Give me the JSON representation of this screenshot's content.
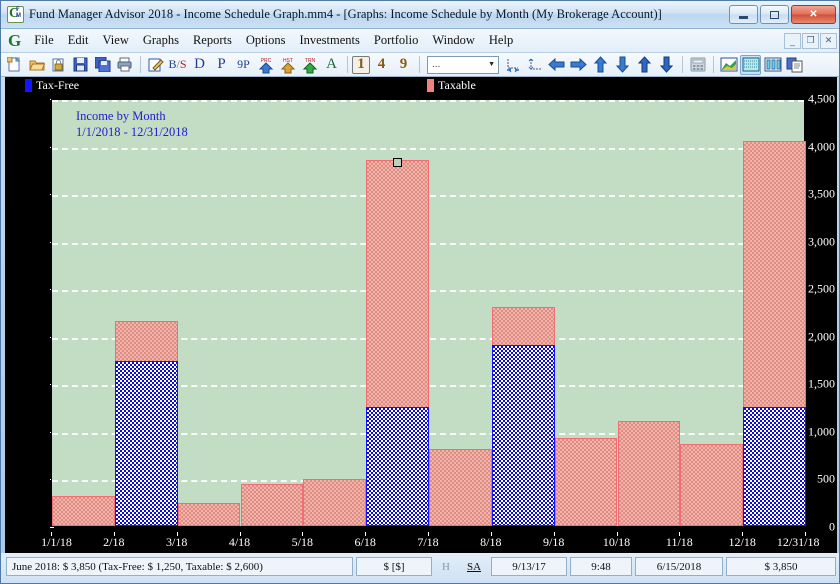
{
  "window": {
    "title": "Fund Manager Advisor 2018 - Income Schedule Graph.mm4 - [Graphs: Income Schedule by Month (My Brokerage Account)]",
    "app_icon": "fund-manager-icon",
    "controls": {
      "minimize": "–",
      "maximize": "□",
      "close": "✕"
    },
    "mdi_controls": {
      "minimize": "_",
      "restore": "❐",
      "close": "✕"
    }
  },
  "menu": {
    "logo": "G",
    "items": [
      "File",
      "Edit",
      "View",
      "Graphs",
      "Reports",
      "Options",
      "Investments",
      "Portfolio",
      "Window",
      "Help"
    ]
  },
  "toolbar": {
    "groups": [
      [
        {
          "name": "new-file-icon",
          "glyph": "❐"
        },
        {
          "name": "open-folder-icon",
          "glyph": "Ὄ2"
        },
        {
          "name": "lock-file-icon",
          "glyph": "❑"
        },
        {
          "name": "save-icon",
          "glyph": "Ὃe"
        },
        {
          "name": "save-all-icon",
          "glyph": "⧉"
        },
        {
          "name": "print-icon",
          "glyph": "⎙"
        }
      ],
      [
        {
          "name": "edit-note-icon",
          "glyph": "✎"
        },
        {
          "name": "bs-ratio-icon",
          "glyph": "B/S"
        },
        {
          "name": "dividend-icon",
          "glyph": "D"
        },
        {
          "name": "price-icon",
          "glyph": "P"
        },
        {
          "name": "nine-price-icon",
          "glyph": "9P"
        },
        {
          "name": "price-update-icon",
          "glyph": "PRC"
        },
        {
          "name": "history-update-icon",
          "glyph": "HST"
        },
        {
          "name": "transaction-update-icon",
          "glyph": "TRN"
        },
        {
          "name": "font-icon",
          "glyph": "A"
        }
      ],
      [
        {
          "name": "view-one-icon",
          "glyph": "1"
        },
        {
          "name": "view-four-icon",
          "glyph": "4"
        },
        {
          "name": "view-nine-icon",
          "glyph": "9"
        }
      ]
    ],
    "combo_value": "...",
    "combo_arrow": "▼",
    "zoom_icons": [
      {
        "name": "fit-horizontal-icon",
        "glyph": "↧"
      },
      {
        "name": "fit-vertical-icon",
        "glyph": "↥"
      }
    ],
    "nav_icons": [
      {
        "name": "arrow-left-icon",
        "glyph": "⬅"
      },
      {
        "name": "arrow-right-icon",
        "glyph": "➡"
      },
      {
        "name": "arrow-up-icon",
        "glyph": "⬆"
      },
      {
        "name": "arrow-down-icon",
        "glyph": "⬇"
      },
      {
        "name": "arrow-up-alt-icon",
        "glyph": "⬆"
      },
      {
        "name": "arrow-down-alt-icon",
        "glyph": "⬇"
      }
    ],
    "right_icons": [
      {
        "name": "calculator-icon",
        "glyph": "⌸"
      },
      {
        "name": "area-chart-icon",
        "glyph": "◢"
      },
      {
        "name": "bar-chart-icon",
        "glyph": "▒"
      },
      {
        "name": "column-chart-icon",
        "glyph": "‖"
      },
      {
        "name": "copy-report-icon",
        "glyph": "⧉"
      }
    ]
  },
  "statusbar": {
    "message": "June 2018: $ 3,850 (Tax-Free: $ 1,250, Taxable: $ 2,600)",
    "currency": "$ [$]",
    "h_flag": "H",
    "sa_flag": "SA",
    "date_short": "9/13/17",
    "time": "9:48",
    "date_long": "6/15/2018",
    "total": "$ 3,850"
  },
  "chart_data": {
    "type": "bar",
    "stacked": true,
    "title": "Income by Month",
    "subtitle": "1/1/2018 - 12/31/2018",
    "xlabel": "",
    "ylabel": "",
    "ylim": [
      0,
      4500
    ],
    "yticks": [
      0,
      500,
      1000,
      1500,
      2000,
      2500,
      3000,
      3500,
      4000,
      4500
    ],
    "ytick_labels": [
      "0",
      "500",
      "1,000",
      "1,500",
      "2,000",
      "2,500",
      "3,000",
      "3,500",
      "4,000",
      "4,500"
    ],
    "grid": true,
    "legend_position": "top",
    "plot_bg": "#c3dcc4",
    "categories": [
      "1/18",
      "2/18",
      "3/18",
      "4/18",
      "5/18",
      "6/18",
      "7/18",
      "8/18",
      "9/18",
      "10/18",
      "11/18",
      "12/18"
    ],
    "xtick_labels": [
      "1/1/18",
      "2/18",
      "3/18",
      "4/18",
      "5/18",
      "6/18",
      "7/18",
      "8/18",
      "9/18",
      "10/18",
      "11/18",
      "12/18",
      "12/31/18"
    ],
    "series": [
      {
        "name": "Tax-Free",
        "color": "#0b0be0",
        "values": [
          0,
          1740,
          0,
          0,
          0,
          1250,
          0,
          1900,
          0,
          0,
          0,
          1250
        ]
      },
      {
        "name": "Taxable",
        "color": "#f0837f",
        "values": [
          320,
          420,
          240,
          440,
          490,
          2600,
          810,
          400,
          930,
          1100,
          860,
          2800
        ]
      }
    ],
    "totals": [
      320,
      2160,
      240,
      440,
      490,
      3850,
      810,
      2300,
      930,
      1100,
      860,
      4050
    ],
    "selected_category": "6/18",
    "selection_marker": true
  }
}
